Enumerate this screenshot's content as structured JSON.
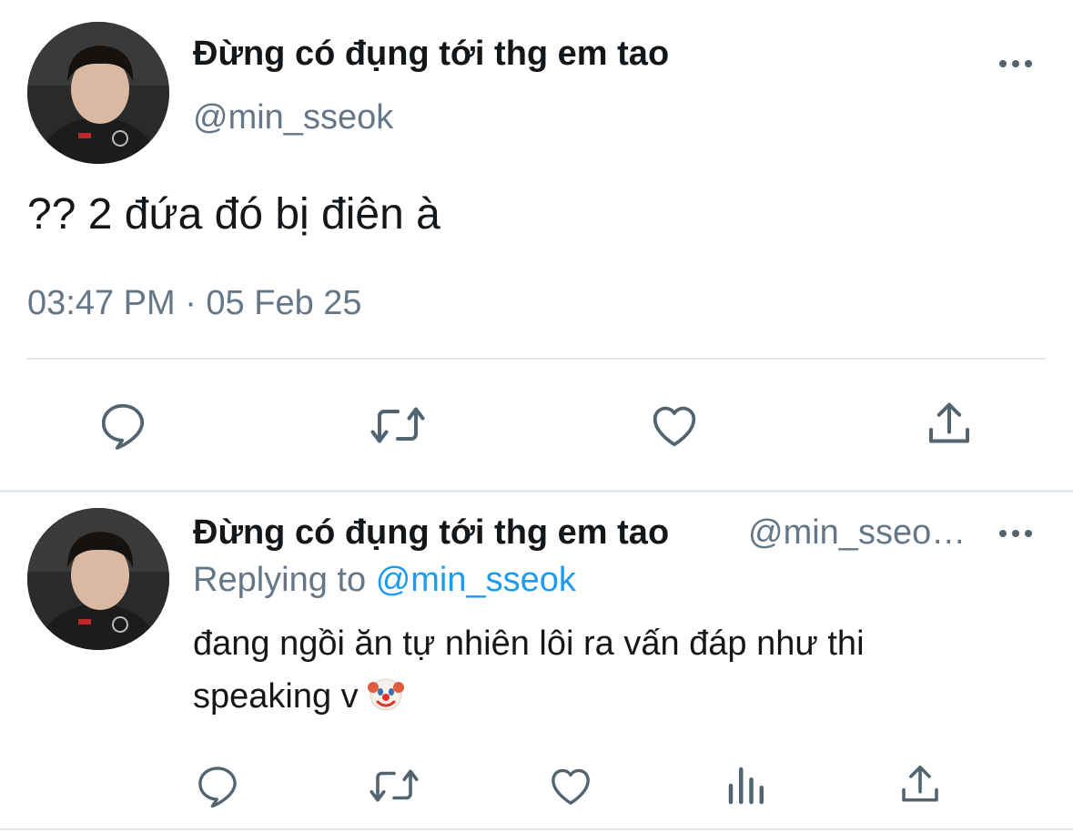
{
  "tweet": {
    "author_name": "Đừng có đụng tới thg em tao",
    "author_handle": "@min_sseok",
    "text": "?? 2 đứa đó bị điên à",
    "timestamp": "03:47 PM · 05 Feb 25",
    "more_icon": "more-horizontal-icon",
    "actions": [
      "reply-icon",
      "retweet-icon",
      "like-icon",
      "share-icon"
    ]
  },
  "reply": {
    "author_name": "Đừng có đụng tới thg em tao",
    "author_handle": "@min_sseo…",
    "replying_label": "Replying to",
    "replying_handle": "@min_sseok",
    "text_line1": "đang ngồi ăn tự nhiên lôi ra vấn đáp như thi",
    "text_line2": "speaking v",
    "emoji": "clown-face-emoji",
    "actions": [
      "reply-icon",
      "retweet-icon",
      "like-icon",
      "analytics-icon",
      "share-icon"
    ]
  },
  "colors": {
    "text": "#14171a",
    "secondary": "#657786",
    "link": "#1d9bf0",
    "divider": "#e1e8ed"
  }
}
